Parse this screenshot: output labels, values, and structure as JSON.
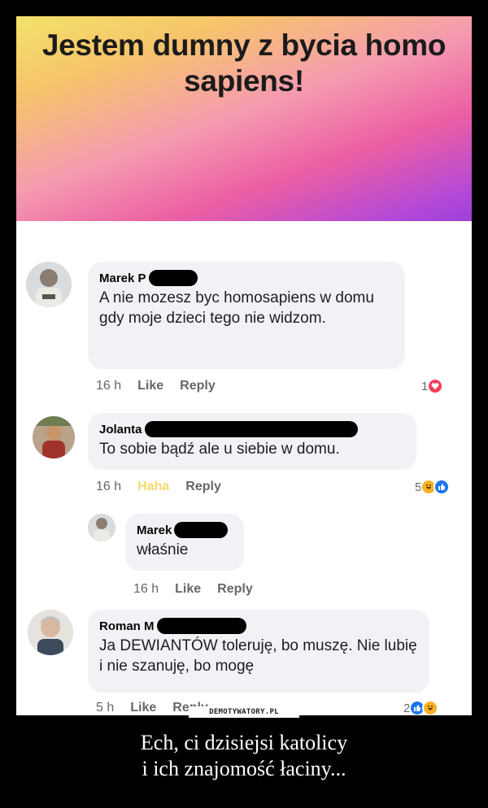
{
  "banner": {
    "title": "Jestem dumny z bycia homo sapiens!"
  },
  "comments": [
    {
      "author": "Marek P",
      "text": "A nie mozesz byc homosapiens w domu gdy moje dzieci tego nie widzom.",
      "time": "16 h",
      "action": "Like",
      "reply": "Reply",
      "reaction_count": "1",
      "reactions": [
        "heart-icon"
      ]
    },
    {
      "author": "Jolanta",
      "text": "To sobie bądź ale u siebie w domu.",
      "time": "16 h",
      "action": "Haha",
      "reply": "Reply",
      "reaction_count": "5",
      "reactions": [
        "haha-icon",
        "like-icon"
      ]
    },
    {
      "author": "Marek",
      "text": "właśnie",
      "time": "16 h",
      "action": "Like",
      "reply": "Reply"
    },
    {
      "author": "Roman M",
      "text": "Ja DEWIANTÓW toleruję, bo muszę. Nie lubię i nie szanuję, bo mogę",
      "time": "5 h",
      "action": "Like",
      "reply": "Reply",
      "reaction_count": "2",
      "reactions": [
        "like-icon",
        "haha-icon"
      ]
    }
  ],
  "watermark": "DEMOTYWATORY.PL",
  "caption": {
    "line1": "Ech, ci dzisiejsi katolicy",
    "line2": "i ich znajomość łaciny..."
  },
  "colors": {
    "haha_text": "#f5d96a",
    "heart": "#f33e58",
    "like": "#1877f2",
    "haha": "#f7b125"
  }
}
